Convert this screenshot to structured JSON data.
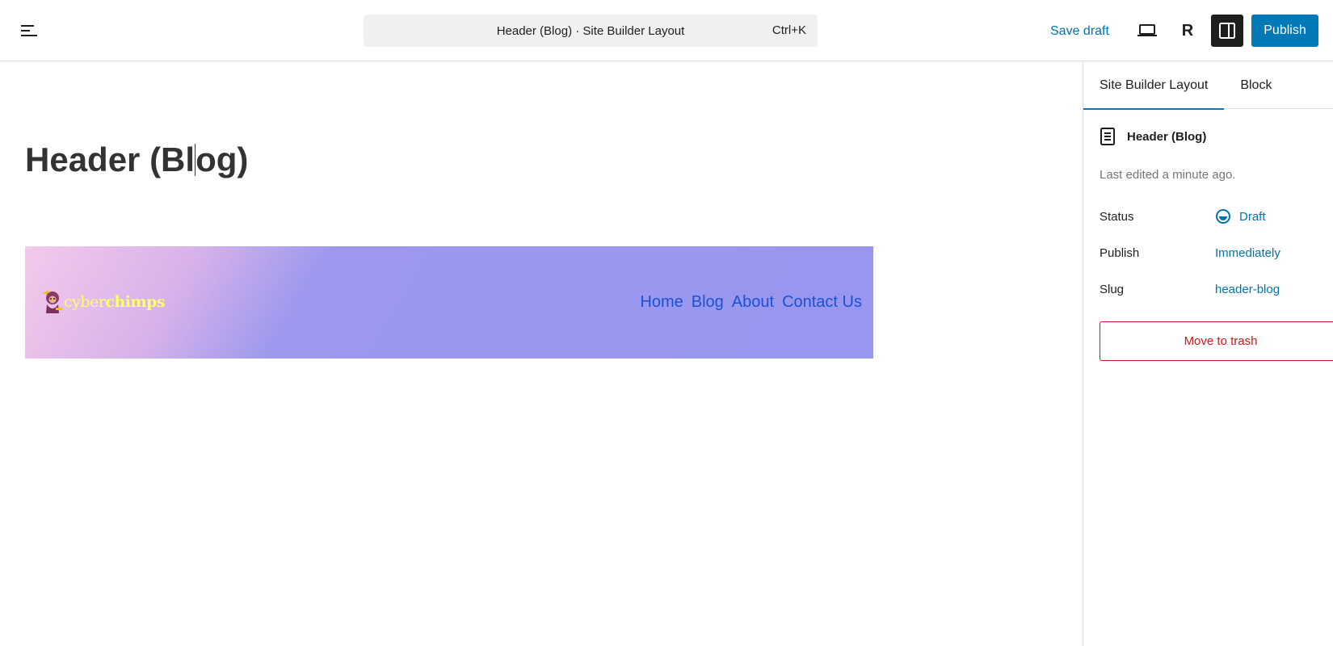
{
  "topbar": {
    "command_title": "Header (Blog) · Site Builder Layout",
    "command_shortcut": "Ctrl+K",
    "save_draft": "Save draft",
    "r_label": "R",
    "publish": "Publish"
  },
  "canvas": {
    "title_before": "Header (Bl",
    "title_after": "og)",
    "logo_text_a": "cyber",
    "logo_text_b": "chimps",
    "nav": [
      "Home",
      "Blog",
      "About",
      "Contact Us"
    ]
  },
  "sidebar": {
    "tabs": [
      "Site Builder Layout",
      "Block"
    ],
    "doc_title": "Header (Blog)",
    "last_edited": "Last edited a minute ago.",
    "rows": [
      {
        "label": "Status",
        "value": "Draft"
      },
      {
        "label": "Publish",
        "value": "Immediately"
      },
      {
        "label": "Slug",
        "value": "header-blog"
      }
    ],
    "trash": "Move to trash"
  },
  "colors": {
    "accent": "#0079b6",
    "link": "#0073aa",
    "danger": "#cc1818",
    "nav_link": "#1a52d6",
    "logo_text": "#ffff66"
  }
}
